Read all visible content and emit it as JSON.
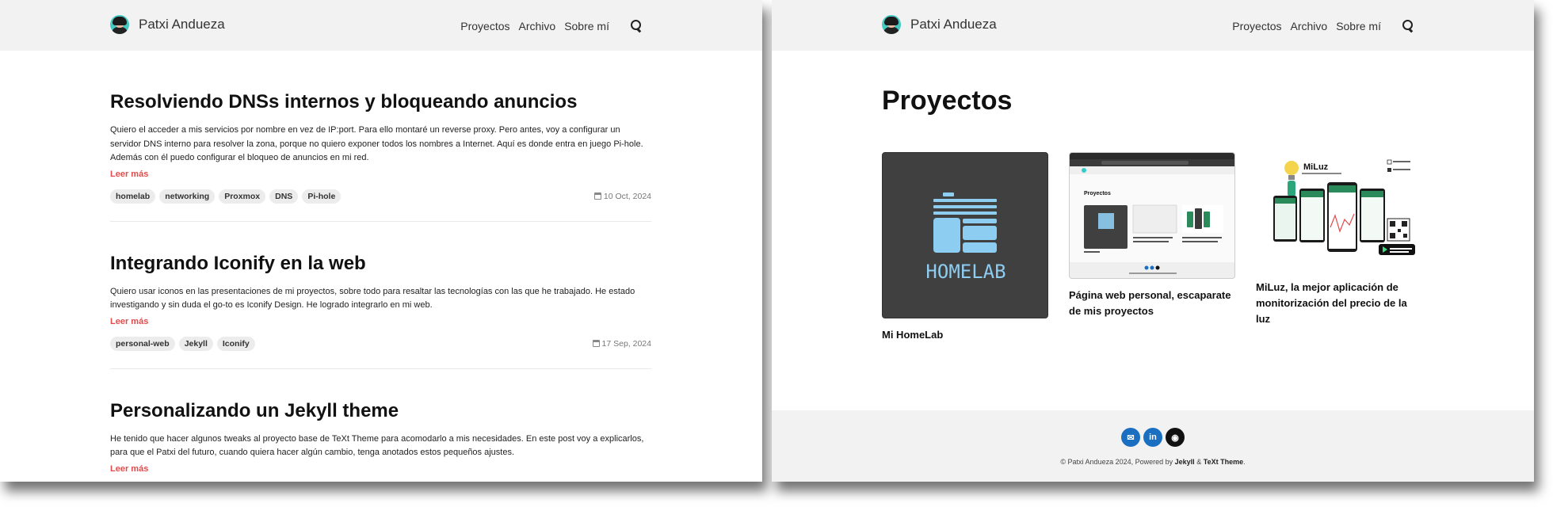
{
  "site": {
    "name": "Patxi Andueza"
  },
  "nav": {
    "items": [
      "Proyectos",
      "Archivo",
      "Sobre mí"
    ]
  },
  "blog": {
    "posts": [
      {
        "title": "Resolviendo DNSs internos y bloqueando anuncios",
        "excerpt": "Quiero el acceder a mis servicios por nombre en vez de IP:port. Para ello montaré un reverse proxy. Pero antes, voy a configurar un servidor DNS interno para resolver la zona, porque no quiero exponer todos los nombres a Internet. Aquí es donde entra en juego Pi-hole. Además con él puedo configurar el bloqueo de anuncios en mi red.",
        "read_more": "Leer más",
        "tags": [
          "homelab",
          "networking",
          "Proxmox",
          "DNS",
          "Pi-hole"
        ],
        "date": "10 Oct, 2024"
      },
      {
        "title": "Integrando Iconify en la web",
        "excerpt": "Quiero usar iconos en las presentaciones de mi proyectos, sobre todo para resaltar las tecnologías con las que he trabajado. He estado investigando y sin duda el go-to es Iconify Design. He logrado integrarlo en mi web.",
        "read_more": "Leer más",
        "tags": [
          "personal-web",
          "Jekyll",
          "Iconify"
        ],
        "date": "17 Sep, 2024"
      },
      {
        "title": "Personalizando un Jekyll theme",
        "excerpt": "He tenido que hacer algunos tweaks al proyecto base de TeXt Theme para acomodarlo a mis necesidades. En este post voy a explicarlos, para que el Patxi del futuro, cuando quiera hacer algún cambio, tenga anotados estos pequeños ajustes.",
        "read_more": "Leer más",
        "tags": [],
        "date": ""
      }
    ]
  },
  "projects": {
    "title": "Proyectos",
    "cards": [
      {
        "caption": "Mi HomeLab",
        "thumb_text": "HOMELAB"
      },
      {
        "caption": "Página web personal, escaparate de mis proyectos",
        "thumb_text": "Proyectos"
      },
      {
        "caption": "MiLuz, la mejor aplicación de monitorización del precio de la luz",
        "thumb_text": "MiLuz"
      }
    ]
  },
  "footer": {
    "social": [
      {
        "icon": "mail-icon",
        "glyph": "✉",
        "color": "#1a6fc0"
      },
      {
        "icon": "linkedin-icon",
        "glyph": "in",
        "color": "#1a6fc0"
      },
      {
        "icon": "github-icon",
        "glyph": "◉",
        "color": "#111111"
      }
    ],
    "copy_prefix": "© Patxi Andueza 2024, Powered by",
    "jekyll": "Jekyll",
    "amp": "&",
    "theme": "TeXt Theme",
    "period": "."
  },
  "colors": {
    "accent": "#e34b4b",
    "header_bg": "#f2f2f2",
    "homelab_icon": "#8ecdf2"
  }
}
